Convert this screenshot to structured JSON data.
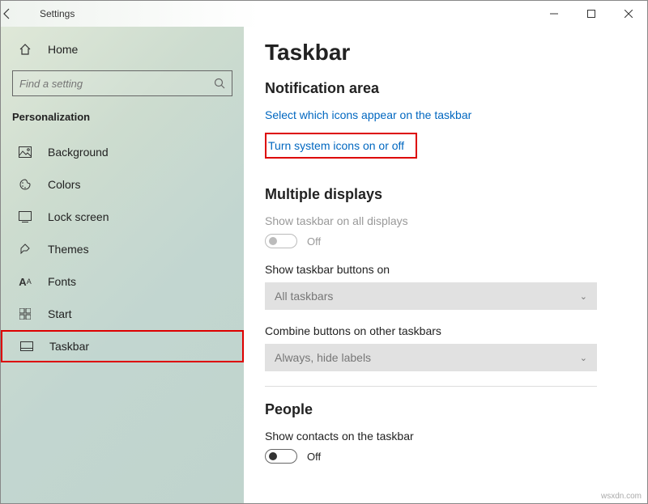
{
  "titlebar": {
    "title": "Settings"
  },
  "sidebar": {
    "home": "Home",
    "search_placeholder": "Find a setting",
    "section": "Personalization",
    "items": [
      {
        "label": "Background"
      },
      {
        "label": "Colors"
      },
      {
        "label": "Lock screen"
      },
      {
        "label": "Themes"
      },
      {
        "label": "Fonts"
      },
      {
        "label": "Start"
      },
      {
        "label": "Taskbar"
      }
    ]
  },
  "content": {
    "title": "Taskbar",
    "notification": {
      "heading": "Notification area",
      "link1": "Select which icons appear on the taskbar",
      "link2": "Turn system icons on or off"
    },
    "multiple": {
      "heading": "Multiple displays",
      "show_all_label": "Show taskbar on all displays",
      "show_all_state": "Off",
      "buttons_on_label": "Show taskbar buttons on",
      "buttons_on_value": "All taskbars",
      "combine_label": "Combine buttons on other taskbars",
      "combine_value": "Always, hide labels"
    },
    "people": {
      "heading": "People",
      "contacts_label": "Show contacts on the taskbar",
      "contacts_state": "Off"
    }
  },
  "watermark": "wsxdn.com"
}
